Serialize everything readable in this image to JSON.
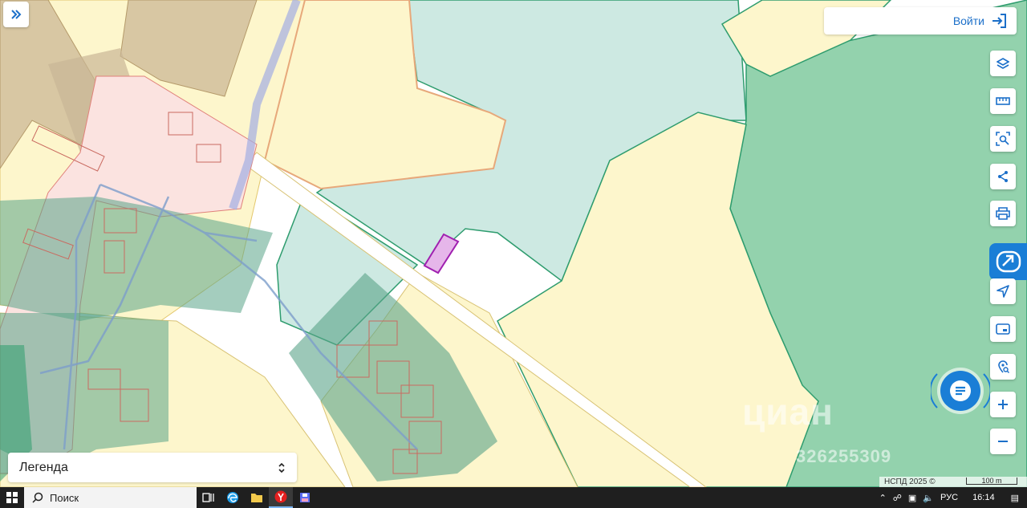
{
  "header": {
    "login_label": "Войти"
  },
  "toolbar": {
    "buttons": [
      "layers-icon",
      "ruler-icon",
      "area-search-icon",
      "share-icon",
      "print-icon",
      "extension-icon",
      "locate-icon",
      "minimap-icon",
      "geo-search-icon",
      "zoom-in-icon",
      "zoom-out-icon"
    ]
  },
  "legend": {
    "label": "Легенда"
  },
  "watermark": {
    "brand": "циан",
    "number": "326255309"
  },
  "map": {
    "attribution": "НСПД 2025 ©",
    "scale_label": "100 m",
    "colors": {
      "forest": "#93d2ad",
      "water": "#cde9e2",
      "field": "#fdf6cc",
      "urban": "#fbe3e0",
      "brown": "#d9c8a5",
      "selected_parcel": "#a020b0"
    }
  },
  "taskbar": {
    "search_placeholder": "Поиск",
    "language": "РУС",
    "time": "16:14"
  }
}
